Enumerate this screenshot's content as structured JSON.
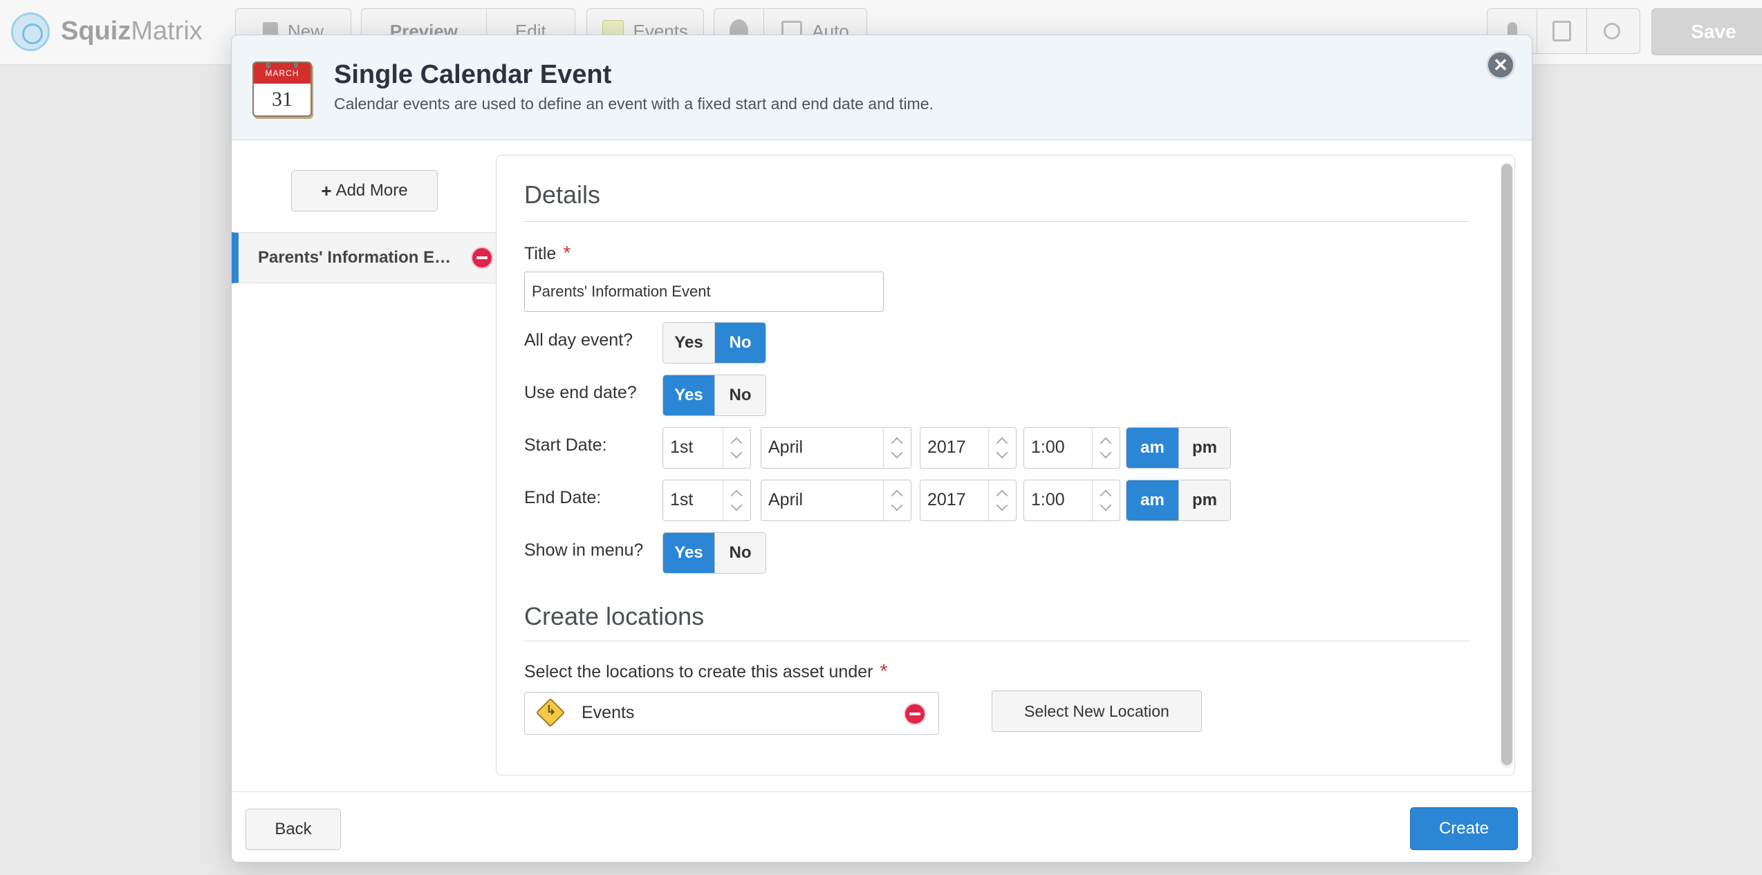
{
  "app": {
    "logo_part1": "Squiz",
    "logo_part2": "Matrix"
  },
  "toolbar": {
    "new_label": "New",
    "preview_label": "Preview",
    "edit_label": "Edit",
    "events_label": "Events",
    "auto_label": "Auto",
    "save_label": "Save"
  },
  "modal": {
    "title": "Single Calendar Event",
    "subtitle": "Calendar events are used to define an event with a fixed start and end date and time.",
    "calendar_icon": {
      "month": "MARCH",
      "day": "31"
    },
    "add_more_label": "Add More",
    "asset_item_label": "Parents' Information Event",
    "details_heading": "Details",
    "title_label": "Title",
    "title_value": "Parents' Information Event",
    "all_day_label": "All day event?",
    "use_end_date_label": "Use end date?",
    "start_date_label": "Start Date:",
    "end_date_label": "End Date:",
    "show_in_menu_label": "Show in menu?",
    "yes_label": "Yes",
    "no_label": "No",
    "am_label": "am",
    "pm_label": "pm",
    "all_day_selected": "No",
    "use_end_date_selected": "Yes",
    "show_in_menu_selected": "Yes",
    "start": {
      "day": "1st",
      "month": "April",
      "year": "2017",
      "time": "1:00",
      "meridiem": "am"
    },
    "end": {
      "day": "1st",
      "month": "April",
      "year": "2017",
      "time": "1:00",
      "meridiem": "am"
    },
    "create_locations_heading": "Create locations",
    "locations_label": "Select the locations to create this asset under",
    "location_name": "Events",
    "select_new_location_label": "Select New Location",
    "back_label": "Back",
    "create_label": "Create"
  },
  "colors": {
    "accent": "#2b86d6",
    "danger": "#e0254a",
    "required": "#d0332b"
  }
}
